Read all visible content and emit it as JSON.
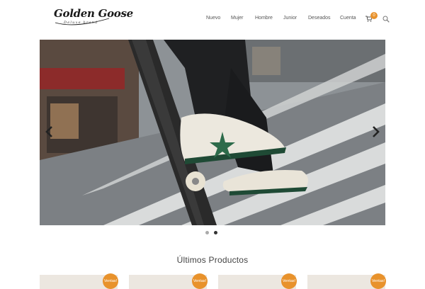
{
  "brand": {
    "name": "Golden Goose",
    "tagline": "Deluxe brand"
  },
  "nav": {
    "items": [
      {
        "label": "Nuevo"
      },
      {
        "label": "Mujer"
      },
      {
        "label": "Hombre"
      },
      {
        "label": "Junior"
      },
      {
        "label": "Deseados"
      },
      {
        "label": "Cuenta"
      }
    ]
  },
  "cart": {
    "count": "0"
  },
  "slider": {
    "total_slides": 2,
    "active_slide": 2
  },
  "products_section": {
    "title": "Últimos Productos",
    "items": [
      {
        "badge": "Ventas!"
      },
      {
        "badge": "Ventas!"
      },
      {
        "badge": "Ventas!"
      },
      {
        "badge": "Ventas!"
      }
    ]
  },
  "colors": {
    "accent": "#e8922c",
    "text": "#555555",
    "dot_active": "#333333",
    "dot_inactive": "#aaaaaa"
  }
}
